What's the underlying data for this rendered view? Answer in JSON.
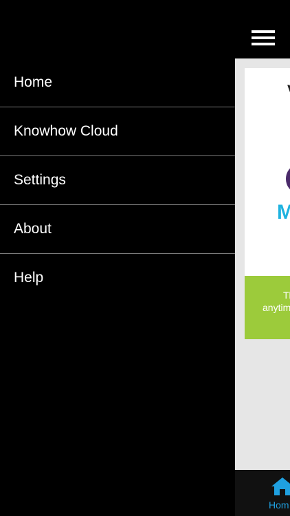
{
  "menu": {
    "items": [
      {
        "label": "Home"
      },
      {
        "label": "Knowhow Cloud"
      },
      {
        "label": "Settings"
      },
      {
        "label": "About"
      },
      {
        "label": "Help"
      }
    ]
  },
  "main": {
    "card_heading": "V",
    "logo_text": "M",
    "banner_line1": "Th",
    "banner_line2": "anytim"
  },
  "tabbar": {
    "home_label": "Hom"
  },
  "colors": {
    "background": "#000000",
    "divider": "#7a7a7a",
    "banner": "#9ccb3b",
    "logo_text": "#1fb3e0",
    "tab_active": "#1fa0e0"
  },
  "icons": {
    "menu": "hamburger-icon",
    "home": "home-icon"
  }
}
